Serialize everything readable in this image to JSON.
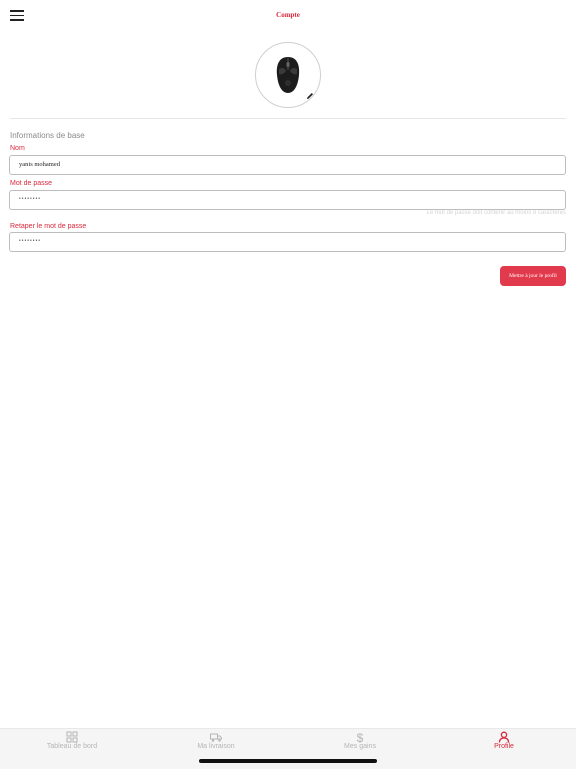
{
  "header": {
    "title": "Compte",
    "menu_icon": "hamburger-menu-icon"
  },
  "profile": {
    "avatar_icon": "gaming-mouse-image",
    "edit_icon": "pencil-icon"
  },
  "form": {
    "section_title": "Informations de base",
    "name_label": "Nom",
    "name_value": "yanis mohamed",
    "password_label": "Mot de passe",
    "password_value": "••••••••",
    "password_hint": "Le mot de passe doit contenir au moins 8 caractères",
    "confirm_label": "Retaper le mot de passe",
    "confirm_value": "••••••••",
    "submit_label": "Mettre à jour le profil"
  },
  "tabs": [
    {
      "label": "Tableau de bord",
      "icon": "dashboard-grid-icon"
    },
    {
      "label": "Ma livraison",
      "icon": "truck-icon"
    },
    {
      "label": "Mes gains",
      "icon": "dollar-icon"
    },
    {
      "label": "Profile",
      "icon": "user-icon"
    }
  ],
  "colors": {
    "accent": "#e23a4d",
    "label": "#d9283c",
    "muted": "#b5b5b5"
  }
}
